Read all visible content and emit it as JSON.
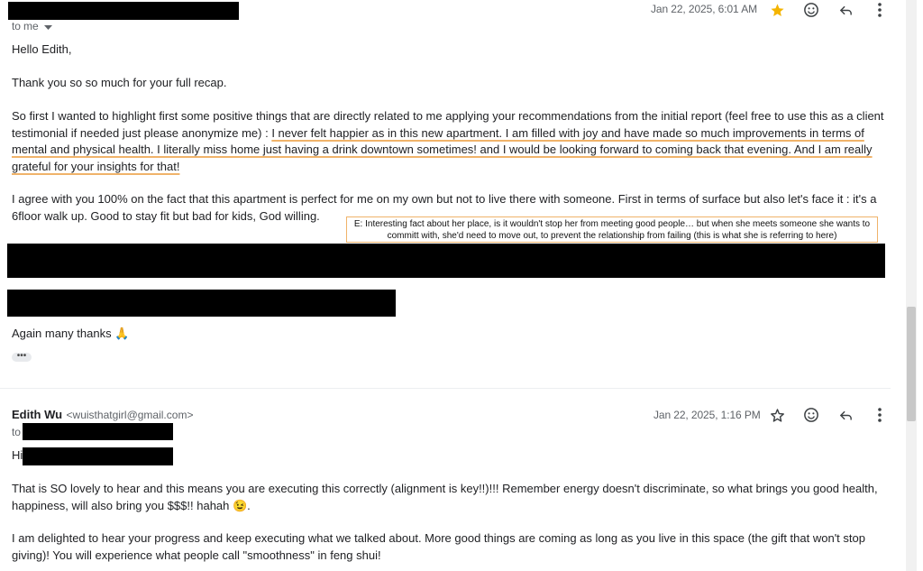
{
  "message1": {
    "date": "Jan 22, 2025, 6:01 AM",
    "to": "to me",
    "greeting": "Hello Edith,",
    "p_thanks": "Thank you so so much for your full recap.",
    "p_highlight_plain": "So first I wanted to highlight first some positive things that are directly related to me applying your recommendations from the initial report (feel free to use this as a client testimonial if needed just please anonymize me) : ",
    "p_highlight_underlined": "I never felt happier as in this new apartment. I am filled with joy and have made so much improvements in terms of mental and physical health. I literally miss home just having a drink downtown sometimes! and I would be looking forward to coming back that evening. And I am really grateful for your insights for that!",
    "p_agree": "I agree with you 100% on the fact that this apartment is perfect for me on my own but not to live there with someone. First in terms of surface but also let's face it : it's a 6floor walk up. Good to stay fit but bad for kids, God willing.",
    "annotation": "E: Interesting fact about her place, is it wouldn't stop her from meeting good people… but when she meets someone she wants to committ with, she'd need to move out, to prevent the relationship from failing (this is what she is referring to here)",
    "closing": "Again many thanks 🙏",
    "trimmed": "•••"
  },
  "message2": {
    "sender_name": "Edith Wu",
    "sender_email": "<wuisthatgirl@gmail.com>",
    "date": "Jan 22, 2025, 1:16 PM",
    "to": "to",
    "greeting": "Hi",
    "p1": "That is SO lovely to hear and this means you are executing this correctly (alignment is key!!)!!! Remember energy doesn't discriminate, so what brings you good health, happiness, will also bring you $$$!! hahah 😉.",
    "p2": "I am delighted to hear your progress and keep executing what we talked about. More good things are coming as long as you live in this space (the gift that won't stop giving)! You will experience what people call \"smoothness\" in feng shui!"
  },
  "colors": {
    "star_filled": "#f4b400",
    "annotation_border": "#f0b36a",
    "underline": "#f0b36a"
  },
  "icons": [
    "star-filled-icon",
    "emoji-icon",
    "reply-icon",
    "more-vert-icon",
    "star-outline-icon",
    "chevron-down-icon"
  ]
}
